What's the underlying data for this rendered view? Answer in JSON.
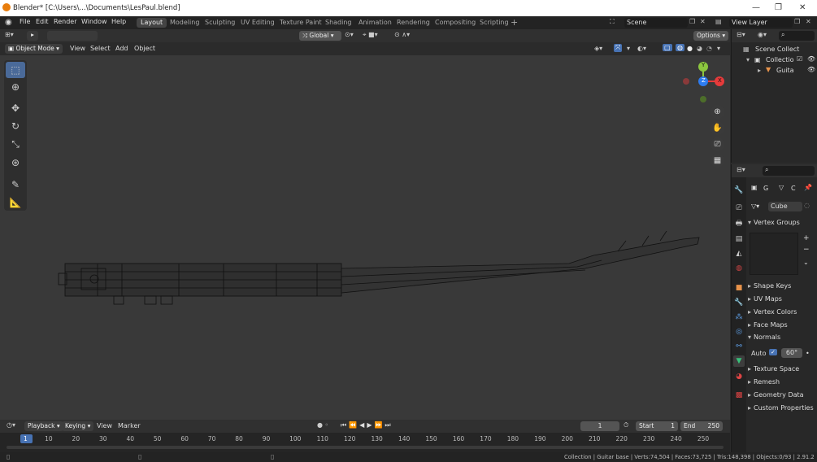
{
  "window": {
    "title": "Blender* [C:\\Users\\...\\Documents\\LesPaul.blend]",
    "min": "—",
    "max": "❐",
    "close": "✕"
  },
  "menu": [
    "File",
    "Edit",
    "Render",
    "Window",
    "Help"
  ],
  "workspaces": [
    "Layout",
    "Modeling",
    "Sculpting",
    "UV Editing",
    "Texture Paint",
    "Shading",
    "Animation",
    "Rendering",
    "Compositing",
    "Scripting"
  ],
  "scene": "Scene",
  "view_layer": "View Layer",
  "viewport": {
    "transform": "Global",
    "options": "Options",
    "mode": "Object Mode",
    "menus": [
      "View",
      "Select",
      "Add",
      "Object"
    ]
  },
  "outliner": {
    "scene_collection": "Scene Collect",
    "collection": "Collection",
    "object": "Guitar"
  },
  "properties": {
    "tab1": "G",
    "tab2": "C",
    "mesh": "Cube",
    "normals_auto": "Auto",
    "angle": "60°",
    "panels": [
      "Vertex Groups",
      "Shape Keys",
      "UV Maps",
      "Vertex Colors",
      "Face Maps",
      "Normals",
      "Texture Space",
      "Remesh",
      "Geometry Data",
      "Custom Properties"
    ]
  },
  "timeline": {
    "menus": [
      "Playback",
      "Keying",
      "View",
      "Marker"
    ],
    "frame": "1",
    "start_label": "Start",
    "start": "1",
    "end_label": "End",
    "end": "250",
    "ticks": [
      "1",
      "10",
      "20",
      "30",
      "40",
      "50",
      "60",
      "70",
      "80",
      "90",
      "100",
      "110",
      "120",
      "130",
      "140",
      "150",
      "160",
      "170",
      "180",
      "190",
      "200",
      "210",
      "220",
      "230",
      "240",
      "250"
    ]
  },
  "status": "Collection | Guitar base | Verts:74,504 | Faces:73,725 | Tris:148,398 | Objects:0/93 | 2.91.2",
  "gizmo": {
    "y": "Y",
    "z": "Z",
    "x": "X"
  },
  "colors": {
    "accent": "#4772b3",
    "x": "#e63b3b",
    "y": "#8cc63f",
    "z": "#2d7cf0"
  }
}
